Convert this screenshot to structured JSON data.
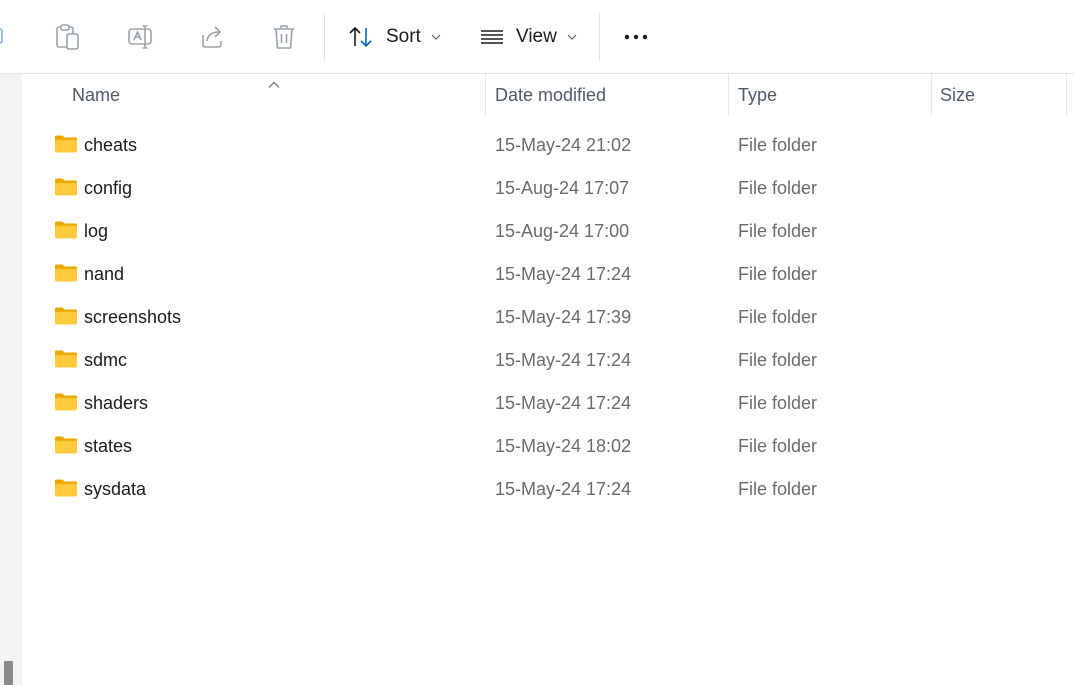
{
  "toolbar": {
    "sort_label": "Sort",
    "view_label": "View",
    "icons": [
      "copy-icon",
      "paste-icon",
      "rename-icon",
      "share-icon",
      "delete-icon",
      "sort-icon",
      "view-icon",
      "more-icon"
    ]
  },
  "columns": {
    "name": "Name",
    "date_modified": "Date modified",
    "type": "Type",
    "size": "Size",
    "sorted_by": "Name",
    "sort_direction": "ascending"
  },
  "rows": [
    {
      "name": "cheats",
      "date": "15-May-24 21:02",
      "type": "File folder",
      "size": ""
    },
    {
      "name": "config",
      "date": "15-Aug-24 17:07",
      "type": "File folder",
      "size": ""
    },
    {
      "name": "log",
      "date": "15-Aug-24 17:00",
      "type": "File folder",
      "size": ""
    },
    {
      "name": "nand",
      "date": "15-May-24 17:24",
      "type": "File folder",
      "size": ""
    },
    {
      "name": "screenshots",
      "date": "15-May-24 17:39",
      "type": "File folder",
      "size": ""
    },
    {
      "name": "sdmc",
      "date": "15-May-24 17:24",
      "type": "File folder",
      "size": ""
    },
    {
      "name": "shaders",
      "date": "15-May-24 17:24",
      "type": "File folder",
      "size": ""
    },
    {
      "name": "states",
      "date": "15-May-24 18:02",
      "type": "File folder",
      "size": ""
    },
    {
      "name": "sysdata",
      "date": "15-May-24 17:24",
      "type": "File folder",
      "size": ""
    }
  ],
  "colors": {
    "accent": "#0067c0",
    "folder_yellow": "#ffcb3d",
    "folder_dark": "#e9a700",
    "disabled_icon": "#9aa3ad"
  }
}
